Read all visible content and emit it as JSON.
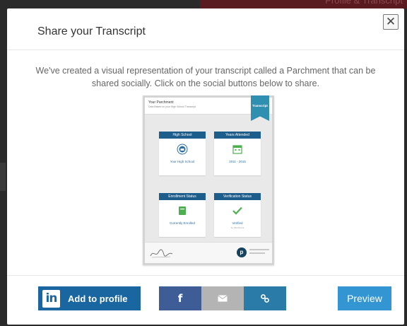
{
  "background": {
    "partial_text": "Profile & Transcript"
  },
  "modal": {
    "title": "Share your Transcript",
    "close_symbol": "✕",
    "description": "We've created a visual representation of your transcript called a Parchment that can be shared socially. Click on the social buttons below to share."
  },
  "parchment_card": {
    "title": "Your Parchment",
    "subtitle": "Data Based on your High School Transcript",
    "ribbon_label": "Transcript",
    "tiles": [
      {
        "header": "High School",
        "icon": "school-seal-icon",
        "value": "Your High School",
        "sub": ""
      },
      {
        "header": "Years Attended",
        "icon": "calendar-icon",
        "value": "2011 - 2015",
        "sub": ""
      },
      {
        "header": "Enrollment Status",
        "icon": "book-icon",
        "value": "Currently Enrolled",
        "sub": ""
      },
      {
        "header": "Verification Status",
        "icon": "checkmark-icon",
        "value": "Verified",
        "sub": "by Parchment"
      }
    ],
    "logo_letter": "p"
  },
  "actions": {
    "linkedin_logo": "in",
    "linkedin_label": "Add to profile",
    "facebook_glyph": "f",
    "email_icon": "envelope-icon",
    "link_icon": "link-icon",
    "preview_label": "Preview"
  },
  "colors": {
    "linkedin": "#1a66a0",
    "facebook": "#3e5d96",
    "email": "#b4b4b4",
    "link": "#2b7ba8",
    "preview": "#3396d3",
    "tile_header": "#1d5d8c"
  }
}
